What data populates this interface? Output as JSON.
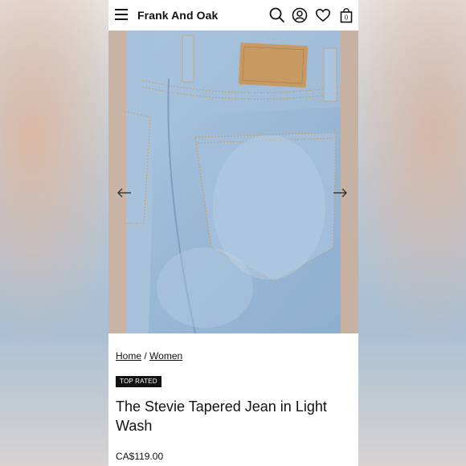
{
  "header": {
    "brand": "Frank And Oak",
    "cart_count": "0",
    "icons": [
      "menu-icon",
      "search-icon",
      "account-icon",
      "heart-icon",
      "bag-icon"
    ]
  },
  "gallery": {
    "prev_icon": "arrow-left-icon",
    "next_icon": "arrow-right-icon"
  },
  "breadcrumb": {
    "home": "Home",
    "separator": "/",
    "women": "Women"
  },
  "product": {
    "badge": "TOP RATED",
    "title": "The Stevie Tapered Jean in Light Wash",
    "price": "CA$119.00"
  },
  "colors": {
    "text": "#111111",
    "badge_bg": "#111111",
    "denim": "#9cb9d6"
  }
}
